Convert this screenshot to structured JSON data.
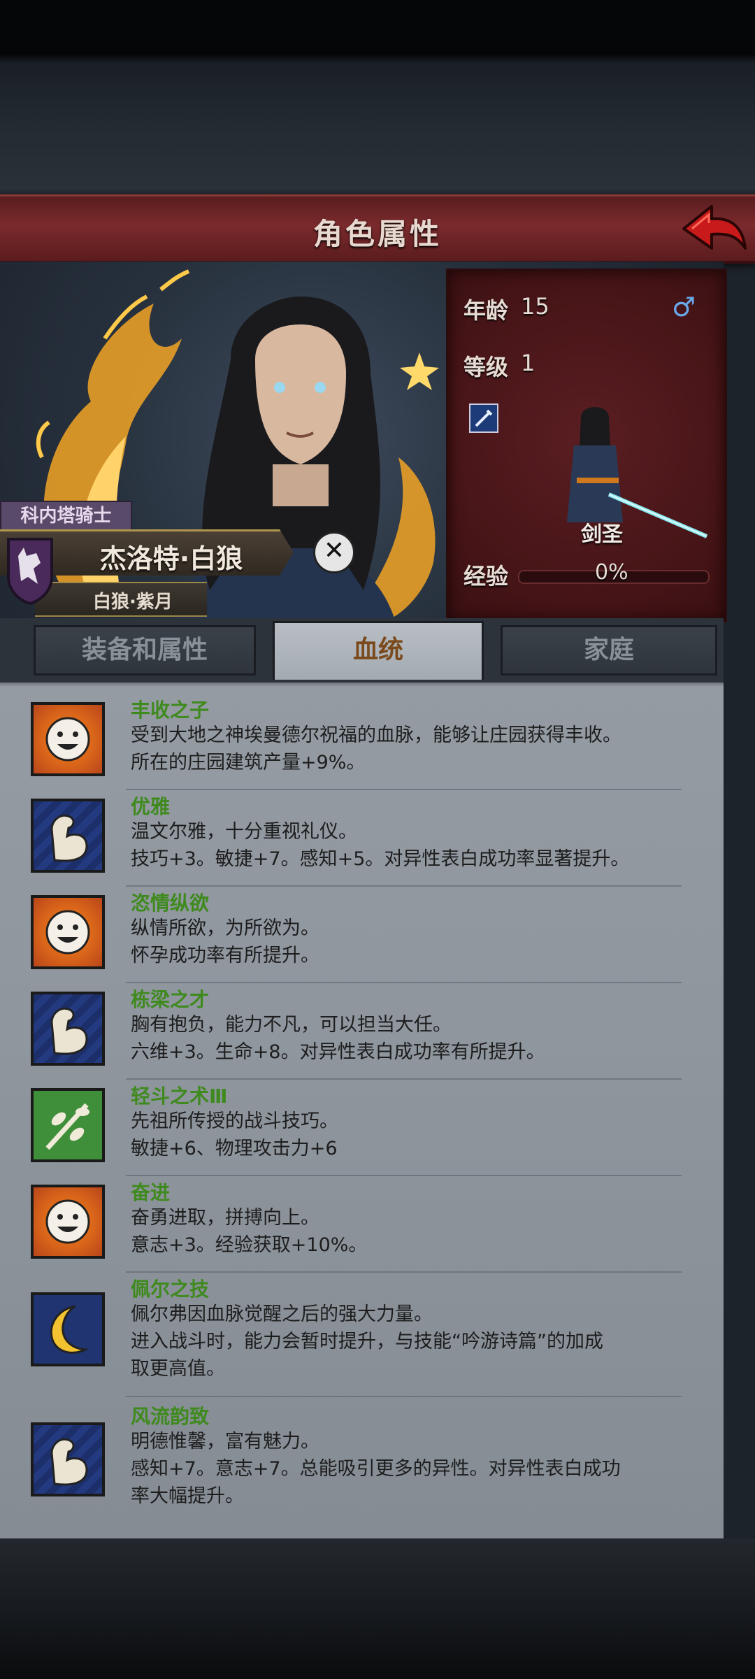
{
  "header": {
    "title": "角色属性"
  },
  "character": {
    "title_tag": "科内塔骑士",
    "name": "杰洛特·白狼",
    "house": "白狼·紫月"
  },
  "stats": {
    "age_label": "年龄",
    "age_value": "15",
    "gender_symbol": "♂",
    "level_label": "等级",
    "level_value": "1",
    "class_name": "剑圣",
    "exp_label": "经验",
    "exp_value": "0%",
    "exp_fraction": 0
  },
  "tabs": [
    {
      "label": "装备和属性",
      "active": false
    },
    {
      "label": "血统",
      "active": true
    },
    {
      "label": "家庭",
      "active": false
    }
  ],
  "traits": [
    {
      "icon": "sun-face-icon",
      "name": "丰收之子",
      "desc": "受到大地之神埃曼德尔祝福的血脉，能够让庄园获得丰收。\n所在的庄园建筑产量+9%。"
    },
    {
      "icon": "flexed-arm-icon",
      "name": "优雅",
      "desc": "温文尔雅，十分重视礼仪。\n技巧+3。敏捷+7。感知+5。对异性表白成功率显著提升。"
    },
    {
      "icon": "sun-face-icon",
      "name": "恣情纵欲",
      "desc": "纵情所欲，为所欲为。\n怀孕成功率有所提升。"
    },
    {
      "icon": "flexed-arm-icon",
      "name": "栋梁之才",
      "desc": "胸有抱负，能力不凡，可以担当大任。\n六维+3。生命+8。对异性表白成功率有所提升。"
    },
    {
      "icon": "leaf-branch-icon",
      "name": "轻斗之术Ⅲ",
      "desc": "先祖所传授的战斗技巧。\n敏捷+6、物理攻击力+6"
    },
    {
      "icon": "sun-face-icon",
      "name": "奋进",
      "desc": "奋勇进取，拼搏向上。\n意志+3。经验获取+10%。"
    },
    {
      "icon": "crescent-moon-icon",
      "name": "佩尔之技",
      "desc": "佩尔弗因血脉觉醒之后的强大力量。\n进入战斗时，能力会暂时提升，与技能“吟游诗篇”的加成\n取更高值。"
    },
    {
      "icon": "flexed-arm-icon",
      "name": "风流韵致",
      "desc": "明德惟馨，富有魅力。\n感知+7。意志+7。总能吸引更多的异性。对异性表白成功\n率大幅提升。"
    }
  ],
  "colors": {
    "header_red": "#7a2a2c",
    "trait_name_green": "#3f8a1e",
    "active_tab_text": "#7a4a1c",
    "gender_blue": "#6aa8e8"
  }
}
